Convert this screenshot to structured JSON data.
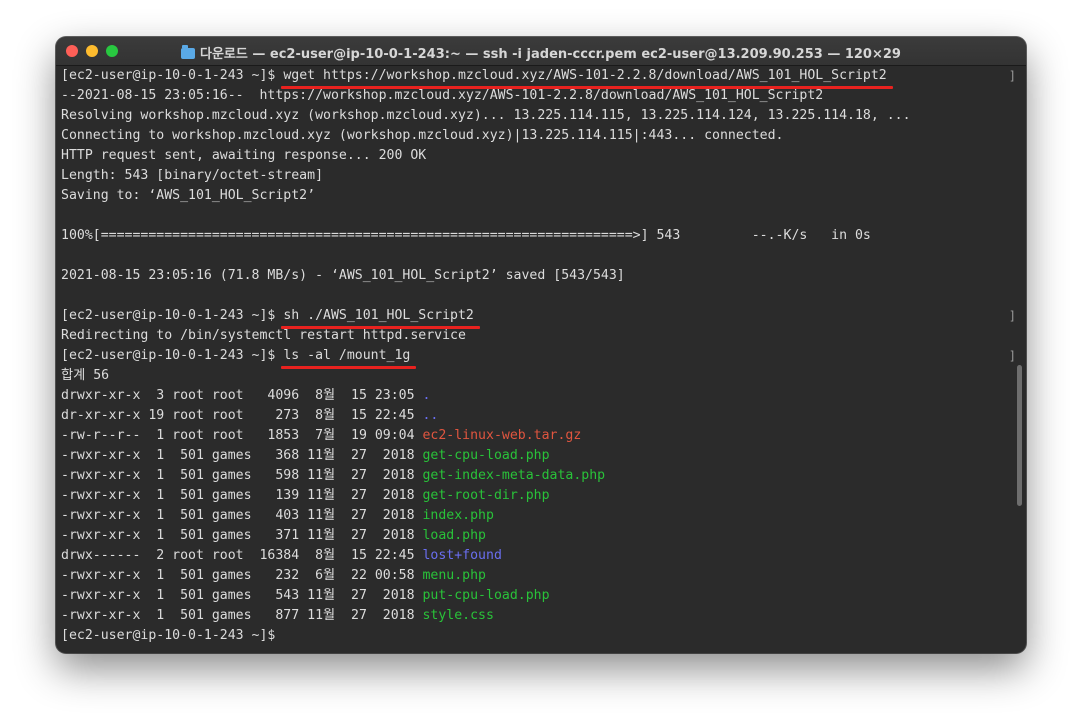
{
  "window": {
    "title": "다운로드 — ec2-user@ip-10-0-1-243:~ — ssh -i jaden-cccr.pem ec2-user@13.209.90.253 — 120×29",
    "folder_icon": "folder-icon"
  },
  "terminal": {
    "prompt": "[ec2-user@ip-10-0-1-243 ~]$ ",
    "commands": [
      "wget https://workshop.mzcloud.xyz/AWS-101-2.2.8/download/AWS_101_HOL_Script2",
      "sh ./AWS_101_HOL_Script2",
      "ls -al /mount_1g"
    ],
    "wget_output": [
      "--2021-08-15 23:05:16--  https://workshop.mzcloud.xyz/AWS-101-2.2.8/download/AWS_101_HOL_Script2",
      "Resolving workshop.mzcloud.xyz (workshop.mzcloud.xyz)... 13.225.114.115, 13.225.114.124, 13.225.114.18, ...",
      "Connecting to workshop.mzcloud.xyz (workshop.mzcloud.xyz)|13.225.114.115|:443... connected.",
      "HTTP request sent, awaiting response... 200 OK",
      "Length: 543 [binary/octet-stream]",
      "Saving to: ‘AWS_101_HOL_Script2’",
      "",
      "100%[===================================================================>] 543         --.-K/s   in 0s",
      "",
      "2021-08-15 23:05:16 (71.8 MB/s) - ‘AWS_101_HOL_Script2’ saved [543/543]",
      ""
    ],
    "script_output": "Redirecting to /bin/systemctl restart httpd.service",
    "ls_total": "합계 56",
    "ls_entries": [
      {
        "meta": "drwxr-xr-x  3 root root   4096  8월  15 23:05 ",
        "name": ".",
        "color": "blue"
      },
      {
        "meta": "dr-xr-xr-x 19 root root    273  8월  15 22:45 ",
        "name": "..",
        "color": "blue"
      },
      {
        "meta": "-rw-r--r--  1 root root   1853  7월  19 09:04 ",
        "name": "ec2-linux-web.tar.gz",
        "color": "red"
      },
      {
        "meta": "-rwxr-xr-x  1  501 games   368 11월  27  2018 ",
        "name": "get-cpu-load.php",
        "color": "green"
      },
      {
        "meta": "-rwxr-xr-x  1  501 games   598 11월  27  2018 ",
        "name": "get-index-meta-data.php",
        "color": "green"
      },
      {
        "meta": "-rwxr-xr-x  1  501 games   139 11월  27  2018 ",
        "name": "get-root-dir.php",
        "color": "green"
      },
      {
        "meta": "-rwxr-xr-x  1  501 games   403 11월  27  2018 ",
        "name": "index.php",
        "color": "green"
      },
      {
        "meta": "-rwxr-xr-x  1  501 games   371 11월  27  2018 ",
        "name": "load.php",
        "color": "green"
      },
      {
        "meta": "drwx------  2 root root  16384  8월  15 22:45 ",
        "name": "lost+found",
        "color": "blue"
      },
      {
        "meta": "-rwxr-xr-x  1  501 games   232  6월  22 00:58 ",
        "name": "menu.php",
        "color": "green"
      },
      {
        "meta": "-rwxr-xr-x  1  501 games   543 11월  27  2018 ",
        "name": "put-cpu-load.php",
        "color": "green"
      },
      {
        "meta": "-rwxr-xr-x  1  501 games   877 11월  27  2018 ",
        "name": "style.css",
        "color": "green"
      }
    ],
    "right_bracket": "]"
  },
  "colors": {
    "background": "#2b2b2b",
    "text": "#dcdcdc",
    "underline": "#e8221f",
    "file_red": "#e0553f",
    "file_green": "#29c239",
    "file_blue": "#6a6ef0"
  }
}
